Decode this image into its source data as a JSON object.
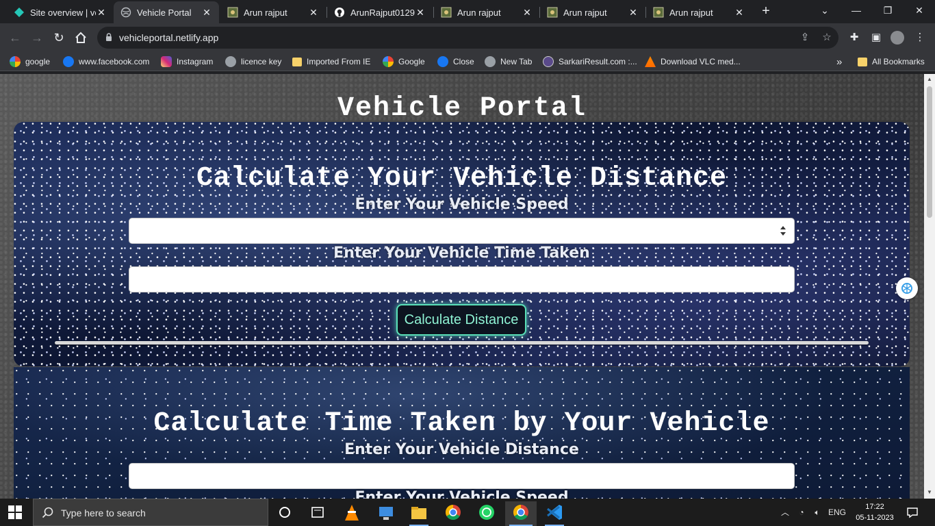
{
  "browser": {
    "tabs": [
      {
        "title": "Site overview | ve",
        "active": false,
        "icon": "netlify-icon"
      },
      {
        "title": "Vehicle Portal",
        "active": true,
        "icon": "globe-icon"
      },
      {
        "title": "Arun rajput",
        "active": false,
        "icon": "image-icon"
      },
      {
        "title": "ArunRajput0129",
        "active": false,
        "icon": "github-icon"
      },
      {
        "title": "Arun rajput",
        "active": false,
        "icon": "image-icon"
      },
      {
        "title": "Arun rajput",
        "active": false,
        "icon": "image-icon"
      },
      {
        "title": "Arun rajput",
        "active": false,
        "icon": "image-icon"
      }
    ],
    "url": "vehicleportal.netlify.app",
    "bookmarks": [
      {
        "label": "google",
        "icon": "google-icon"
      },
      {
        "label": "www.facebook.com",
        "icon": "facebook-icon"
      },
      {
        "label": "Instagram",
        "icon": "instagram-icon"
      },
      {
        "label": "licence key",
        "icon": "globe-icon"
      },
      {
        "label": "Imported From IE",
        "icon": "folder-icon"
      },
      {
        "label": "Google",
        "icon": "google-icon"
      },
      {
        "label": "Close",
        "icon": "facebook-icon"
      },
      {
        "label": "New Tab",
        "icon": "globe-icon"
      },
      {
        "label": "SarkariResult.com :...",
        "icon": "site-icon"
      },
      {
        "label": "Download VLC med...",
        "icon": "vlc-icon"
      }
    ],
    "all_bookmarks": "All Bookmarks",
    "overflow": "»"
  },
  "page": {
    "title": "Vehicle Portal",
    "distance_card": {
      "heading": "Calculate Your Vehicle Distance",
      "speed_label": "Enter Your Vehicle Speed",
      "speed_value": "",
      "time_label": "Enter Your Vehicle Time Taken",
      "time_value": "",
      "button": "Calculate Distance"
    },
    "time_card": {
      "heading": "Calculate Time Taken by Your Vehicle",
      "distance_label": "Enter Your Vehicle Distance",
      "distance_value": "",
      "speed_label": "Enter Your Vehicle Speed"
    }
  },
  "taskbar": {
    "search_placeholder": "Type here to search",
    "language": "ENG",
    "time": "17:22",
    "date": "05-11-2023",
    "apps": [
      "cortana-icon",
      "task-view-icon",
      "vlc-icon",
      "desktop-app-icon",
      "file-explorer-icon",
      "chrome-icon",
      "whatsapp-icon",
      "chrome-icon",
      "vscode-icon"
    ]
  },
  "colors": {
    "button_border": "#5ae0b8",
    "button_text": "#8ff3d4",
    "chrome_dark": "#202124",
    "chrome_toolbar": "#35363a"
  }
}
